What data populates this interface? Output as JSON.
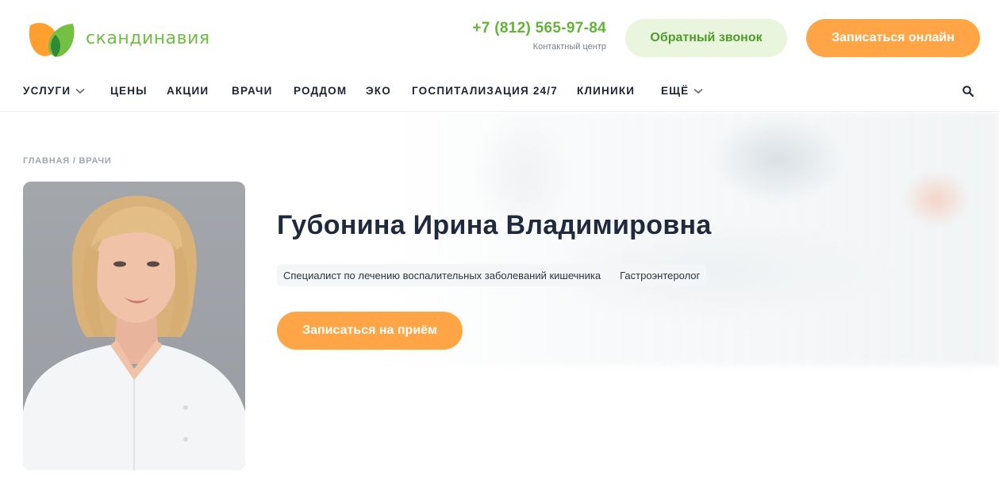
{
  "header": {
    "logo_text": "скандинавия",
    "phone": "+7 (812) 565-97-84",
    "contact_note": "Контактный центр",
    "callback_label": "Обратный звонок",
    "online_label": "Записаться онлайн"
  },
  "nav": {
    "items": [
      {
        "label": "УСЛУГИ",
        "dropdown": true
      },
      {
        "label": "ЦЕНЫ"
      },
      {
        "label": "АКЦИИ"
      },
      {
        "label": "ВРАЧИ"
      },
      {
        "label": "РОДДОМ"
      },
      {
        "label": "ЭКО"
      },
      {
        "label": "ГОСПИТАЛИЗАЦИЯ 24/7"
      },
      {
        "label": "КЛИНИКИ"
      },
      {
        "label": "ЕЩЁ",
        "dropdown": true
      }
    ],
    "search_icon": "search-icon"
  },
  "breadcrumb": "ГЛАВНАЯ / ВРАЧИ",
  "doctor": {
    "name": "Губонина Ирина Владимировна",
    "tags": [
      "Специалист по лечению воспалительных заболеваний кишечника",
      "Гастроэнтеролог"
    ],
    "appoint_label": "Записаться на приём"
  },
  "colors": {
    "brand_green": "#6fbe44",
    "accent_orange": "#ffa545",
    "callback_bg": "#e9f5dd",
    "text_dark": "#1f2a3c"
  }
}
